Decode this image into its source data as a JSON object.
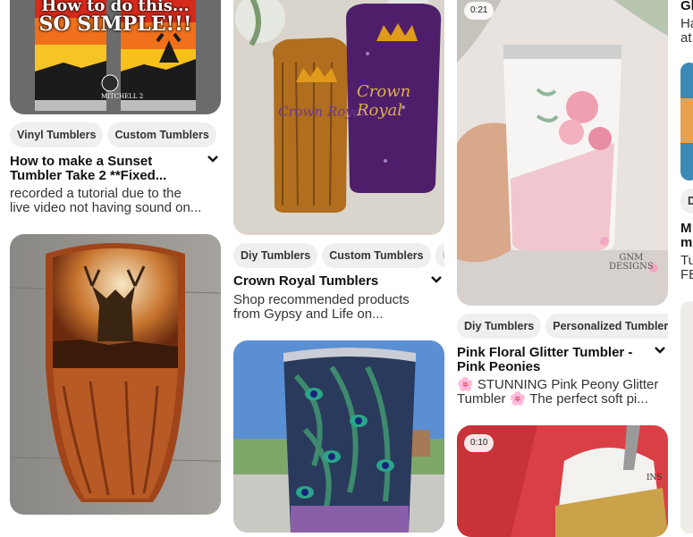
{
  "pins": [
    {
      "id": "sunset",
      "overlay_text": "SO SIMPLE!!!",
      "overlay_text_top": "How to do this...",
      "watermark": "MITCHELL 2",
      "tags": [
        "Vinyl Tumblers",
        "Custom Tumblers"
      ],
      "title_line1": "How to make a Sunset",
      "title_line2": "Tumbler Take 2 **Fixed...",
      "desc_line1": "recorded a tutorial due to the",
      "desc_line2": "live video not having sound on..."
    },
    {
      "id": "elk"
    },
    {
      "id": "crown",
      "logo_text_left": "Crown Royal",
      "logo_text_right": "Crown Royal",
      "tags": [
        "Diy Tumblers",
        "Custom Tumblers",
        "Gl"
      ],
      "title": "Crown Royal Tumblers",
      "desc_line1": "Shop recommended products",
      "desc_line2": "from Gypsy and Life on..."
    },
    {
      "id": "peacock"
    },
    {
      "id": "floral",
      "duration": "0:21",
      "watermark_line1": "GNM",
      "watermark_line2": "DESIGNS",
      "tags": [
        "Diy Tumblers",
        "Personalized Tumblers"
      ],
      "title_line1": "Pink Floral Glitter Tumbler -",
      "title_line2": "Pink Peonies",
      "desc_line1": "🌸 STUNNING Pink Peony Glitter",
      "desc_line2": "Tumbler 🌸 The perfect soft pi..."
    },
    {
      "id": "white-glitter",
      "duration": "0:10",
      "cup_text": "INS"
    },
    {
      "id": "right-edge",
      "title_line1": "Gl",
      "title_fragment": "M",
      "title_fragment2": "m",
      "desc_line1": "Ha",
      "desc_line2": "at",
      "desc2_line1": "Tu",
      "desc2_line2": "FE",
      "tag": "D"
    }
  ],
  "colors": {
    "tag_bg": "#efefef",
    "text": "#111111",
    "muted_tag": "#c8c8c8"
  }
}
